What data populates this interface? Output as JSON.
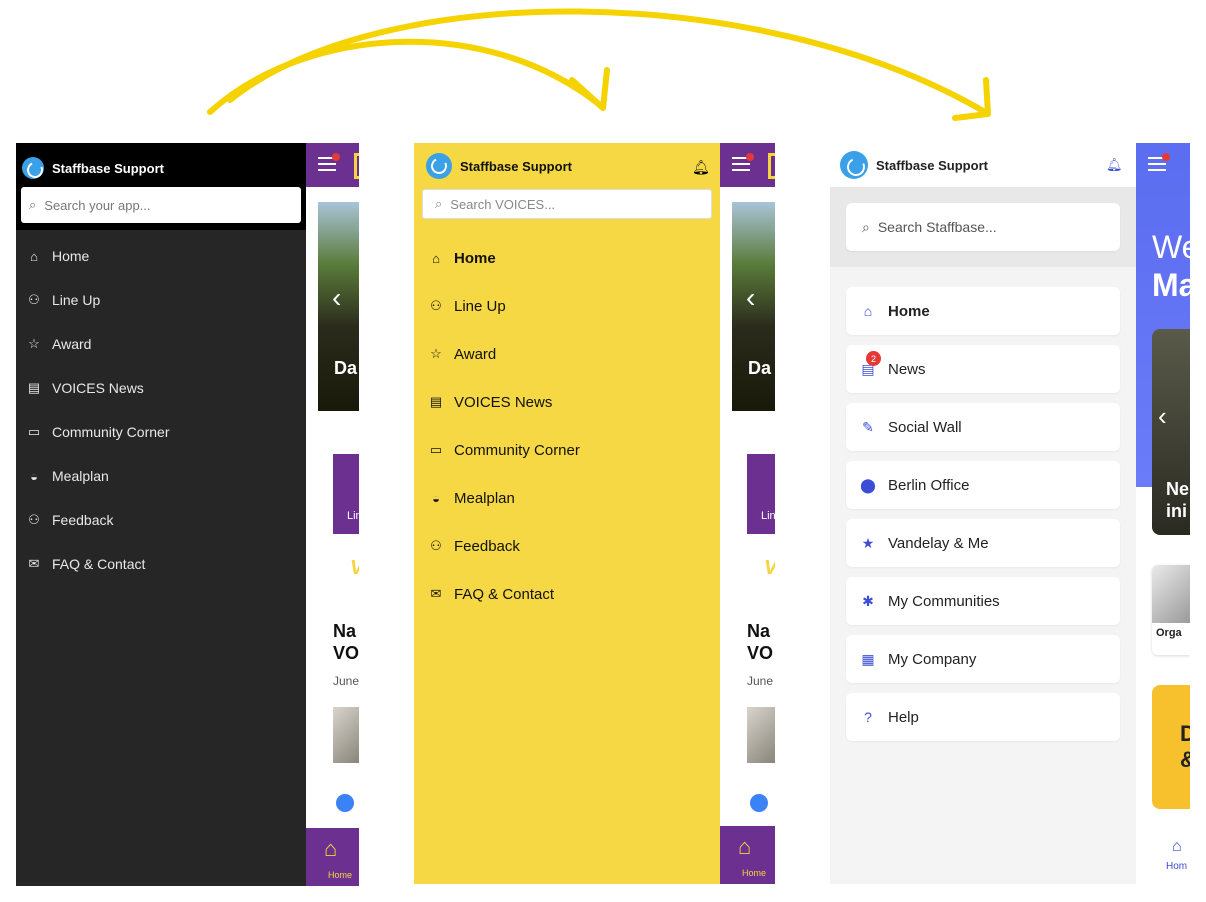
{
  "panels": {
    "dark": {
      "brand": "Staffbase Support",
      "search_placeholder": "Search your app...",
      "menu": [
        {
          "label": "Home",
          "icon": "home-icon"
        },
        {
          "label": "Line Up",
          "icon": "people-icon"
        },
        {
          "label": "Award",
          "icon": "star-icon"
        },
        {
          "label": "VOICES News",
          "icon": "document-icon"
        },
        {
          "label": "Community Corner",
          "icon": "chat-bubble-icon"
        },
        {
          "label": "Mealplan",
          "icon": "burger-icon"
        },
        {
          "label": "Feedback",
          "icon": "feedback-icon"
        },
        {
          "label": "FAQ & Contact",
          "icon": "mail-icon"
        }
      ],
      "background_app": {
        "hero_text": "Da",
        "card_label": "Lin",
        "yellow_text": "V",
        "news_title_line1": "Na",
        "news_title_line2": "VO",
        "news_date": "June",
        "bottom_nav_label": "Home"
      }
    },
    "yellow": {
      "brand": "Staffbase Support",
      "search_placeholder": "Search VOICES...",
      "menu": [
        {
          "label": "Home",
          "icon": "home-icon",
          "active": true
        },
        {
          "label": "Line Up",
          "icon": "people-icon"
        },
        {
          "label": "Award",
          "icon": "star-icon"
        },
        {
          "label": "VOICES News",
          "icon": "document-icon"
        },
        {
          "label": "Community Corner",
          "icon": "chat-bubble-icon"
        },
        {
          "label": "Mealplan",
          "icon": "burger-icon"
        },
        {
          "label": "Feedback",
          "icon": "feedback-icon"
        },
        {
          "label": "FAQ & Contact",
          "icon": "mail-icon"
        }
      ],
      "background_app": {
        "hero_text": "Da",
        "card_label": "Lin",
        "yellow_text": "V",
        "news_title_line1": "Na",
        "news_title_line2": "VO",
        "news_date": "June",
        "bottom_nav_label": "Home"
      }
    },
    "light": {
      "brand": "Staffbase Support",
      "search_placeholder": "Search Staffbase...",
      "menu": [
        {
          "label": "Home",
          "icon": "home-icon",
          "active": true
        },
        {
          "label": "News",
          "icon": "news-icon",
          "badge": "2"
        },
        {
          "label": "Social Wall",
          "icon": "edit-icon"
        },
        {
          "label": "Berlin Office",
          "icon": "location-pin-icon"
        },
        {
          "label": "Vandelay & Me",
          "icon": "star-icon"
        },
        {
          "label": "My Communities",
          "icon": "network-icon"
        },
        {
          "label": "My Company",
          "icon": "building-icon"
        },
        {
          "label": "Help",
          "icon": "help-icon"
        }
      ],
      "background_app": {
        "welcome_line1": "We",
        "welcome_line2": "Ma",
        "news_line1": "Ne",
        "news_line2": "ini",
        "orga_label": "Orga",
        "yellow_line1": "D",
        "yellow_line2": "&",
        "bottom_nav_label": "Hom"
      }
    }
  },
  "colors": {
    "arrow": "#f5d300",
    "dark_drawer": "#262626",
    "yellow_drawer": "#f6d844",
    "accent_blue": "#3b4cd6",
    "app_purple": "#6c3090"
  }
}
